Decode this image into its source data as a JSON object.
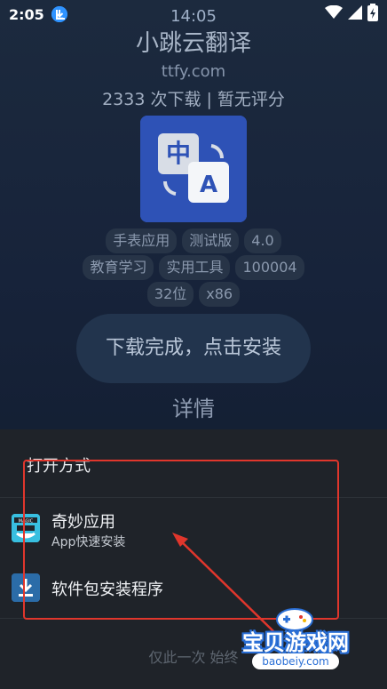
{
  "status_bar": {
    "time": "2:05",
    "download_icon": "download-circle-icon",
    "wifi_icon": "wifi-icon",
    "signal_icon": "signal-icon",
    "battery_icon": "battery-charging-icon"
  },
  "background_page": {
    "clock": "14:05",
    "app_name": "小跳云翻译",
    "domain": "ttfy.com",
    "stats": "2333 次下载 | 暂无评分",
    "app_icon": "translate-icon",
    "tags_row1": [
      "手表应用",
      "测试版",
      "4.0"
    ],
    "tags_row2": [
      "教育学习",
      "实用工具",
      "100004"
    ],
    "tags_row3": [
      "32位",
      "x86"
    ],
    "download_button": "下载完成，点击安装",
    "details_label": "详情",
    "footer_partial": "仅此一次 始终"
  },
  "sheet": {
    "title": "打开方式",
    "options": [
      {
        "name": "奇妙应用",
        "subtitle": "App快速安装",
        "icon": "qimiao-app-icon"
      },
      {
        "name": "软件包安装程序",
        "subtitle": "",
        "icon": "package-installer-icon"
      }
    ]
  },
  "annotation": {
    "highlight_color": "#e0362c",
    "arrow": "pointer-arrow"
  },
  "watermark": {
    "text": "宝贝游戏网",
    "url": "baobeiy.com"
  }
}
